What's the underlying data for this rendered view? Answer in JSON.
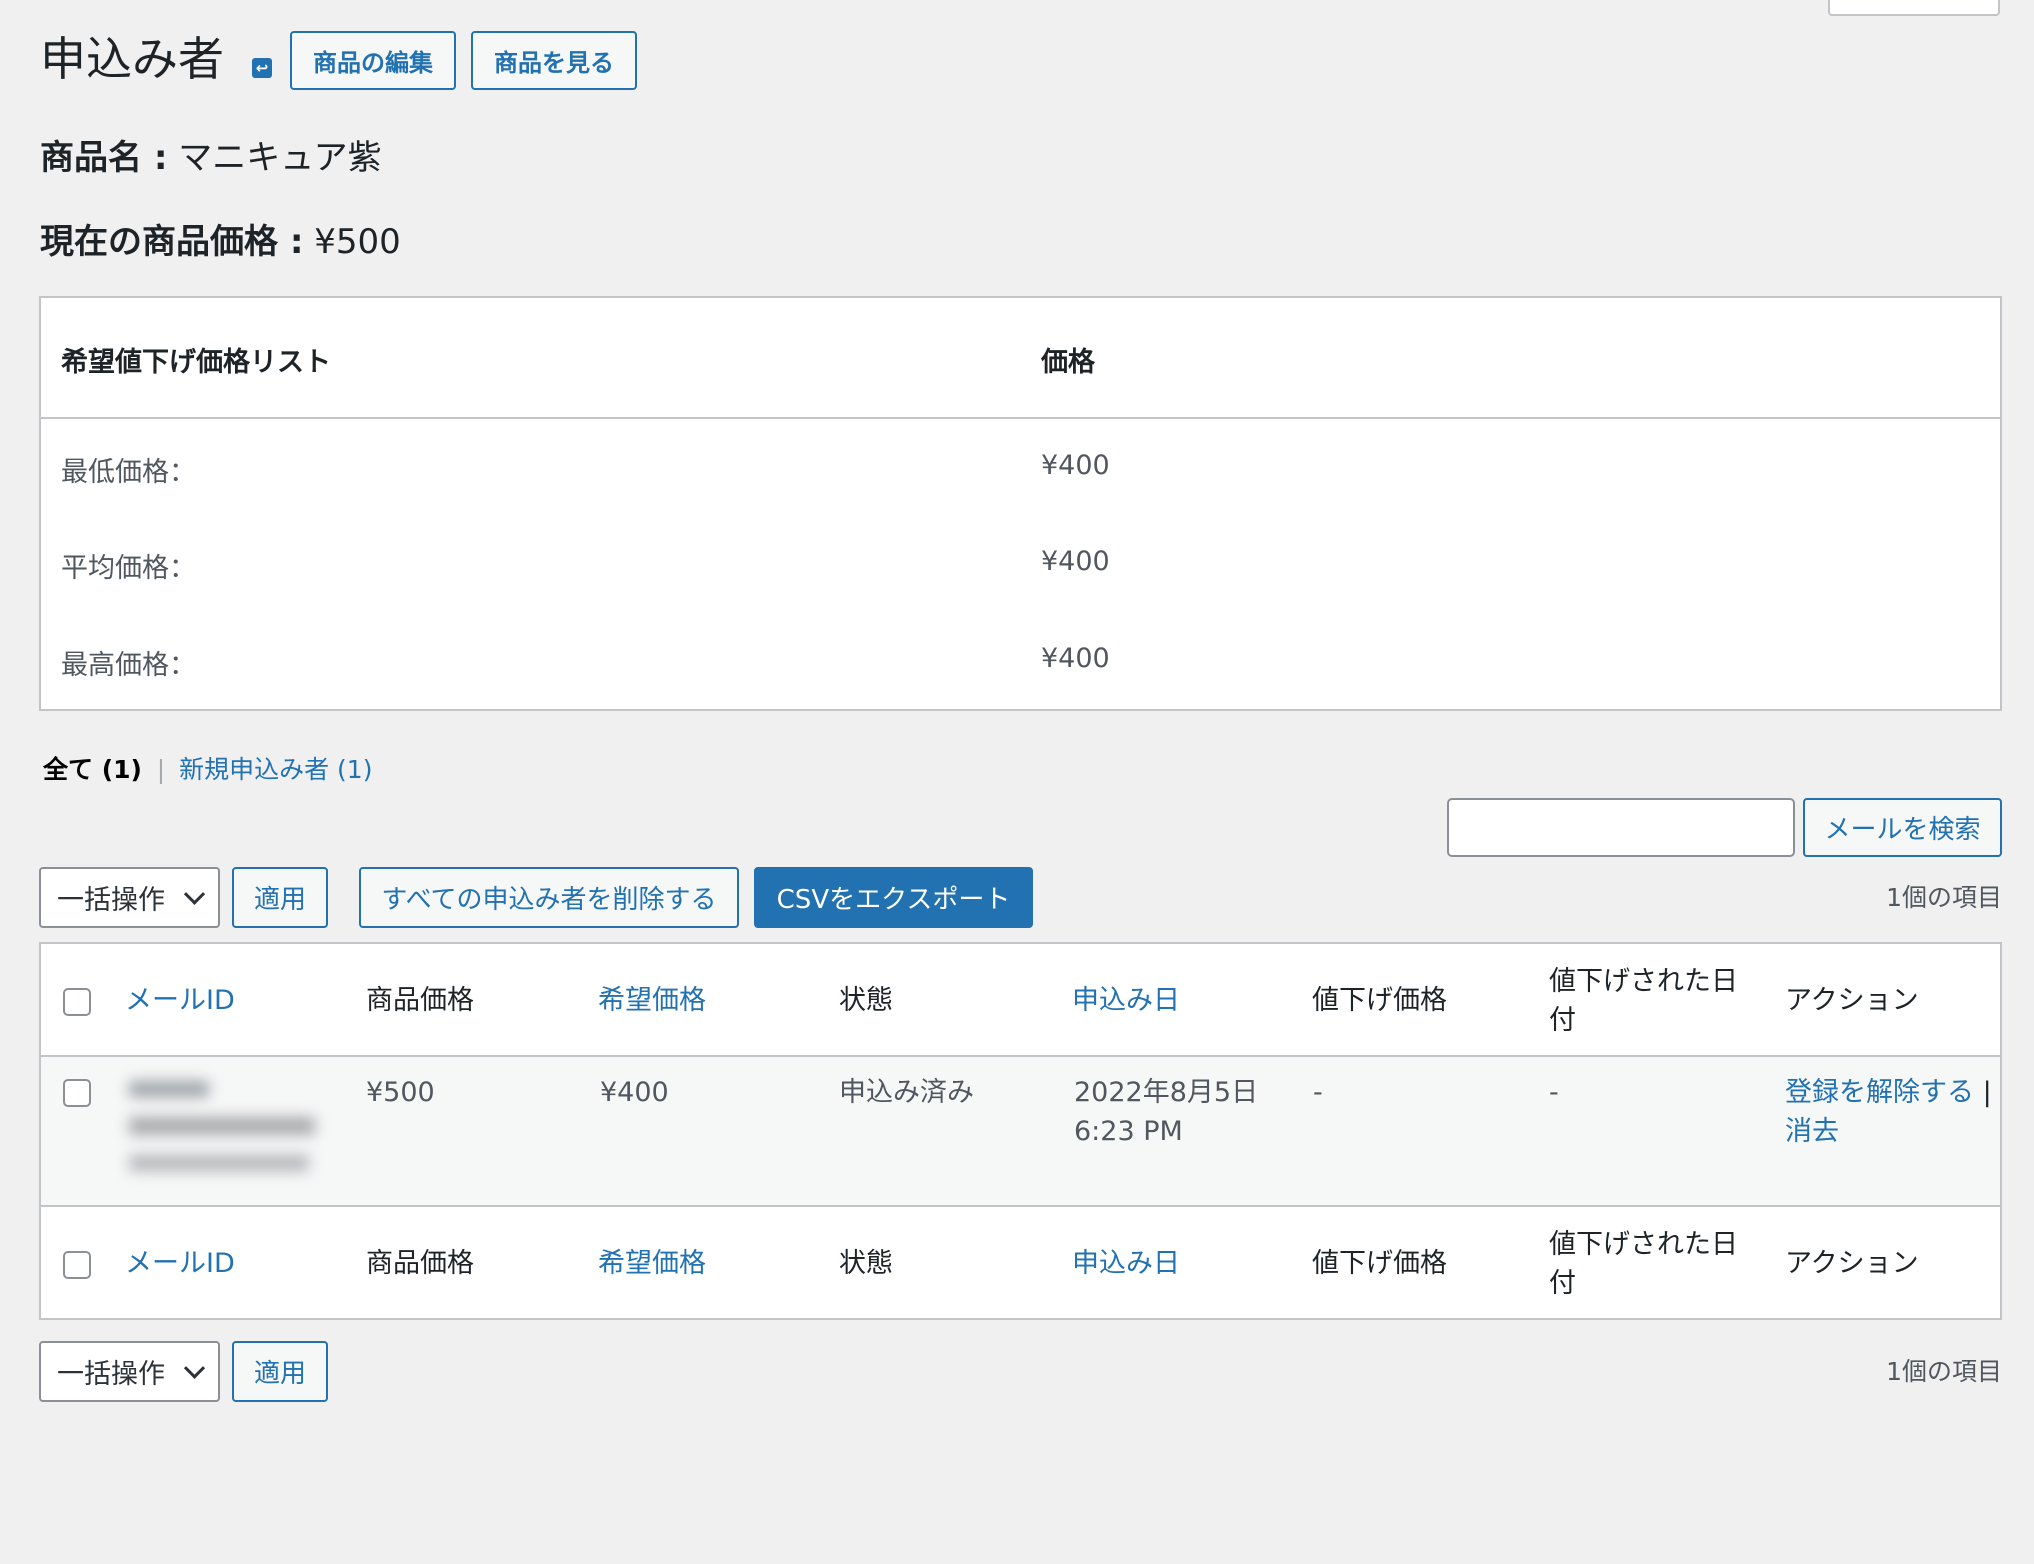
{
  "header": {
    "title": "申込み者",
    "edit_button": "商品の編集",
    "view_button": "商品を見る"
  },
  "product": {
    "name_label": "商品名 :",
    "name_value": "マニキュア紫",
    "price_label": "現在の商品価格 :",
    "price_value": "¥500"
  },
  "price_list": {
    "headers": [
      "希望値下げ価格リスト",
      "価格"
    ],
    "rows": [
      {
        "label": "最低価格：",
        "value": "¥400"
      },
      {
        "label": "平均価格：",
        "value": "¥400"
      },
      {
        "label": "最高価格：",
        "value": "¥400"
      }
    ]
  },
  "filters": {
    "all": "全て",
    "all_count": "(1)",
    "separator": "|",
    "new": "新規申込み者 (1)"
  },
  "search": {
    "value": "",
    "button": "メールを検索"
  },
  "toolbar": {
    "bulk_action": "一括操作",
    "apply": "適用",
    "delete_all": "すべての申込み者を削除する",
    "export_csv": "CSVをエクスポート",
    "item_count": "1個の項目"
  },
  "table": {
    "columns": {
      "email": "メールID",
      "product_price": "商品価格",
      "desired_price": "希望価格",
      "status": "状態",
      "applied_date": "申込み日",
      "reduced_price": "値下げ価格",
      "reduced_date_1": "値下げされた日",
      "reduced_date_2": "付",
      "action": "アクション"
    },
    "rows": [
      {
        "product_price": "¥500",
        "desired_price": "¥400",
        "status": "申込み済み",
        "date_line1": "2022年8月5日",
        "date_line2": "6:23 PM",
        "reduced_price": "-",
        "reduced_date": "-",
        "action_unsubscribe": "登録を解除する",
        "action_sep": "|",
        "action_delete": "消去"
      }
    ]
  },
  "colors": {
    "accent": "#2271b1",
    "background": "#f0f0f1",
    "panel": "#ffffff",
    "border": "#c3c4c7"
  }
}
